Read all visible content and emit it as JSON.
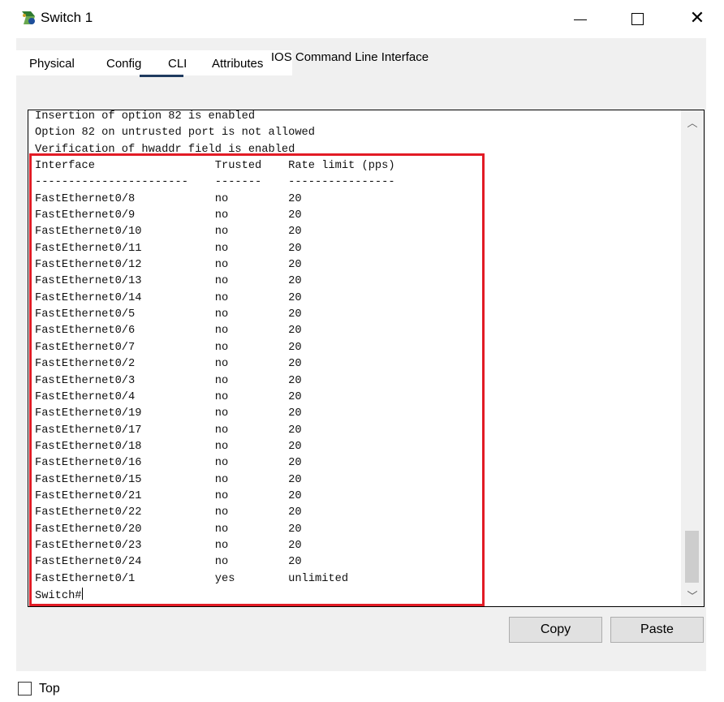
{
  "window": {
    "title": "Switch 1",
    "icon": "switch-app-icon"
  },
  "tabs": [
    {
      "label": "Physical"
    },
    {
      "label": "Config"
    },
    {
      "label": "CLI"
    },
    {
      "label": "Attributes"
    }
  ],
  "active_tab": "CLI",
  "cli": {
    "heading": "IOS Command Line Interface",
    "lines": [
      "Insertion of option 82 is enabled",
      "Option 82 on untrusted port is not allowed",
      "Verification of hwaddr field is enabled",
      "Interface                  Trusted    Rate limit (pps)",
      "-----------------------    -------    ----------------",
      "FastEthernet0/8            no         20",
      "FastEthernet0/9            no         20",
      "FastEthernet0/10           no         20",
      "FastEthernet0/11           no         20",
      "FastEthernet0/12           no         20",
      "FastEthernet0/13           no         20",
      "FastEthernet0/14           no         20",
      "FastEthernet0/5            no         20",
      "FastEthernet0/6            no         20",
      "FastEthernet0/7            no         20",
      "FastEthernet0/2            no         20",
      "FastEthernet0/3            no         20",
      "FastEthernet0/4            no         20",
      "FastEthernet0/19           no         20",
      "FastEthernet0/17           no         20",
      "FastEthernet0/18           no         20",
      "FastEthernet0/16           no         20",
      "FastEthernet0/15           no         20",
      "FastEthernet0/21           no         20",
      "FastEthernet0/22           no         20",
      "FastEthernet0/20           no         20",
      "FastEthernet0/23           no         20",
      "FastEthernet0/24           no         20",
      "FastEthernet0/1            yes        unlimited"
    ],
    "prompt": "Switch#"
  },
  "buttons": {
    "copy": "Copy",
    "paste": "Paste"
  },
  "top_checkbox": {
    "label": "Top",
    "checked": false
  },
  "colors": {
    "highlight": "#e21b25",
    "tab_underline": "#1f3a5f"
  }
}
